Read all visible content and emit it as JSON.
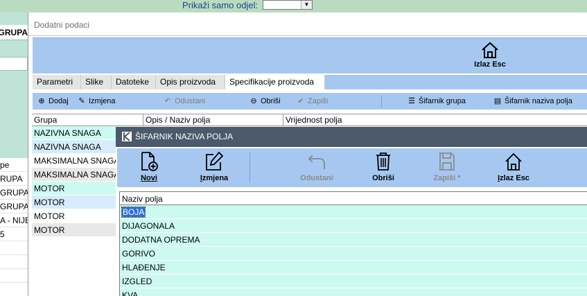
{
  "background": {
    "filter_label": "Prikaži samo odjel:",
    "filter_value": "",
    "grupa_header": "GRUPA",
    "column_header": "pe",
    "rows": [
      "RUPA",
      "GRUPA",
      "GRUPA",
      "A - NIJE",
      "5"
    ]
  },
  "window": {
    "title": "Dodatni podaci",
    "exit_label": "Izlaz Esc",
    "tabs": [
      "Parametri",
      "Slike",
      "Datoteke",
      "Opis proizvoda",
      "Specifikacije proizvoda"
    ],
    "active_tab": "Specifikacije proizvoda",
    "subtoolbar": {
      "add": "Dodaj",
      "edit": "Izmjena",
      "cancel": "Odustani",
      "delete": "Obriši",
      "save": "Zapiši",
      "group_codes": "Šifarnik grupa",
      "field_codes": "Šifarnik naziva polja"
    },
    "grid": {
      "columns": [
        "Grupa",
        "Opis / Naziv polja",
        "Vrijednost polja"
      ],
      "rows": [
        "NAZIVNA SNAGA",
        "NAZIVNA SNAGA",
        "MAKSIMALNA SNAGA",
        "MAKSIMALNA SNAGA",
        "MOTOR",
        "MOTOR",
        "MOTOR",
        "MOTOR"
      ]
    }
  },
  "dialog": {
    "title": "ŠIFARNIK NAZIVA POLJA",
    "buttons": {
      "new": "Novi",
      "edit": "Izmjena",
      "cancel": "Odustani",
      "delete": "Obriši",
      "save": "Zapiši *",
      "exit": "Izlaz Esc"
    },
    "grid": {
      "column": "Naziv polja",
      "rows": [
        "BOJA",
        "DIJAGONALA",
        "DODATNA OPREMA",
        "GORIVO",
        "HLAĐENJE",
        "IZGLED",
        "KVA"
      ],
      "selected": "BOJA"
    }
  },
  "colors": {
    "toolbar": "#a6c8f0",
    "dialog_title": "#4b5a6a",
    "row_teal": "#cdfaf0",
    "row_white": "#ffffff",
    "row_gray": "#e8e8e8",
    "row_blue": "#d6ecfb",
    "filter_text": "#1f3f8c",
    "bg_green": "#b9dcc0"
  }
}
